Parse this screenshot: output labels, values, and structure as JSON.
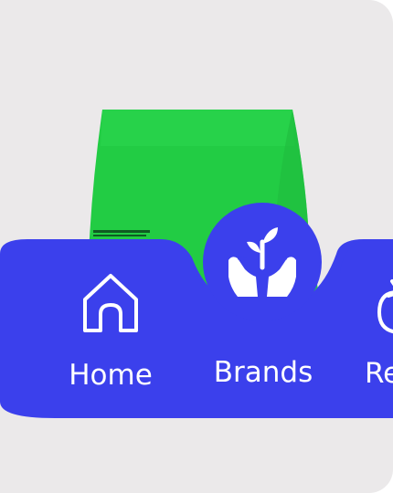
{
  "colors": {
    "card_background": "#ebe9ea",
    "accent": "#3b40ec",
    "product": "#22cc44",
    "icon": "#ffffff"
  },
  "product": {
    "icon": "shorts-product-image"
  },
  "nav": {
    "items": [
      {
        "label": "Home",
        "icon": "home-icon",
        "active": false
      },
      {
        "label": "Brands",
        "icon": "plant-in-hands-icon",
        "active": true
      },
      {
        "label": "Re",
        "icon": "refresh-icon",
        "active": false
      }
    ]
  }
}
